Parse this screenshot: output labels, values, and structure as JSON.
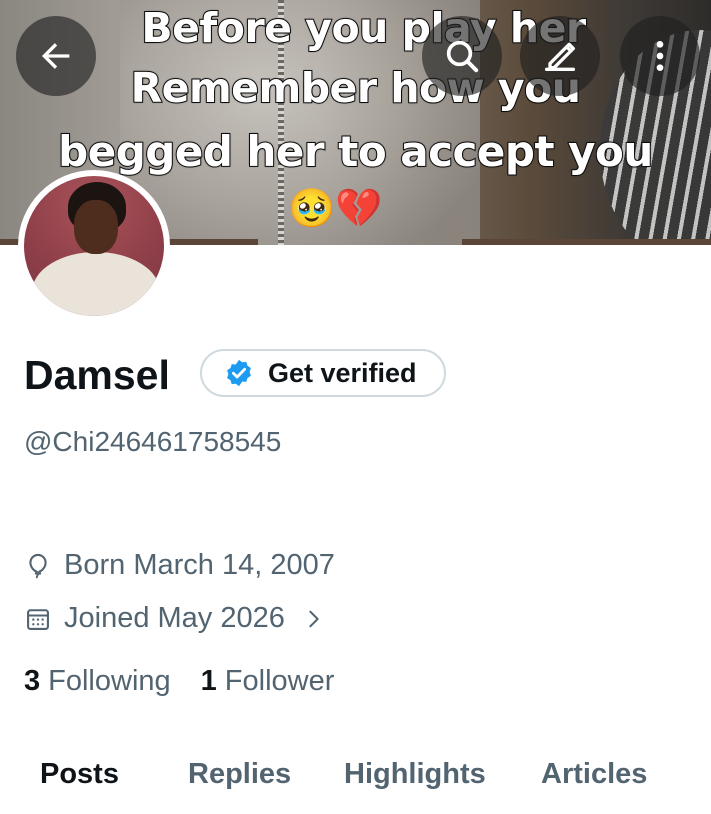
{
  "banner": {
    "meme_lines": [
      "Before you play her",
      "Remember how you",
      "begged her to accept you"
    ],
    "emojis": "🥹💔"
  },
  "header": {
    "back_icon": "arrow-left-icon",
    "search_icon": "search-icon",
    "edit_icon": "edit-icon",
    "more_icon": "more-vertical-icon"
  },
  "profile": {
    "name": "Damsel",
    "verify_label": "Get verified",
    "handle": "@Chi246461758545",
    "born": "Born March 14, 2007",
    "joined": "Joined May 2026",
    "following_count": "3",
    "following_label": "Following",
    "followers_count": "1",
    "followers_label": "Follower"
  },
  "tabs": [
    {
      "label": "Posts",
      "active": true
    },
    {
      "label": "Replies",
      "active": false
    },
    {
      "label": "Highlights",
      "active": false
    },
    {
      "label": "Articles",
      "active": false
    }
  ],
  "colors": {
    "accent": "#1d9bf0",
    "text_primary": "#0f1419",
    "text_secondary": "#536471",
    "border": "#cfd9de"
  }
}
